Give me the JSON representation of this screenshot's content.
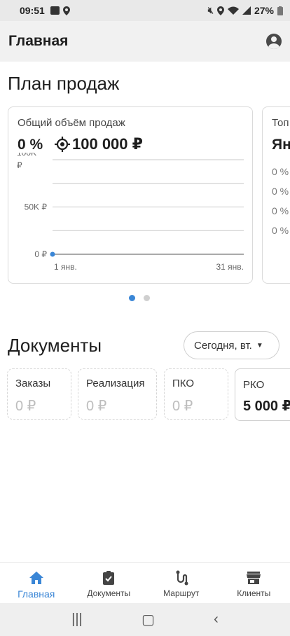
{
  "status_bar": {
    "time": "09:51",
    "battery": "27%",
    "icons": [
      "app-icon",
      "location-icon",
      "mute-icon",
      "location-icon",
      "wifi-icon",
      "signal-icon",
      "battery-icon"
    ]
  },
  "app_bar": {
    "title": "Главная",
    "account_icon": "account-circle-icon"
  },
  "sales_plan": {
    "title": "План продаж",
    "card": {
      "label": "Общий объём продаж",
      "percent": "0 %",
      "target": "100 000 ₽"
    },
    "peek_card": {
      "label": "Топ",
      "big": "Ян",
      "rows": [
        "0 %",
        "0 %",
        "0 %",
        "0 %"
      ]
    },
    "pager": {
      "count": 2,
      "active": 0
    }
  },
  "chart_data": {
    "type": "line",
    "x": [
      "1 янв."
    ],
    "x_tick_labels": [
      "1 янв.",
      "31 янв."
    ],
    "series": [
      {
        "values": [
          0
        ]
      }
    ],
    "y_tick_labels": [
      "100K ₽",
      "50K ₽",
      "0 ₽"
    ],
    "ylim": [
      0,
      100000
    ],
    "grid": true,
    "colors": {
      "point": "#3a86d6"
    }
  },
  "documents": {
    "title": "Документы",
    "period_select": "Сегодня, вт.",
    "cards": [
      {
        "label": "Заказы",
        "value": "0 ₽"
      },
      {
        "label": "Реализация",
        "value": "0 ₽"
      },
      {
        "label": "ПКО",
        "value": "0 ₽"
      },
      {
        "label": "РКО",
        "value": "5 000 ₽"
      }
    ]
  },
  "bottom_nav": {
    "items": [
      {
        "label": "Главная",
        "icon": "home-icon",
        "active": true
      },
      {
        "label": "Документы",
        "icon": "clipboard-check-icon",
        "active": false
      },
      {
        "label": "Маршрут",
        "icon": "route-icon",
        "active": false
      },
      {
        "label": "Клиенты",
        "icon": "store-icon",
        "active": false
      }
    ]
  },
  "colors": {
    "accent": "#3a86d6",
    "appbar_bg": "#f1f1f1"
  }
}
